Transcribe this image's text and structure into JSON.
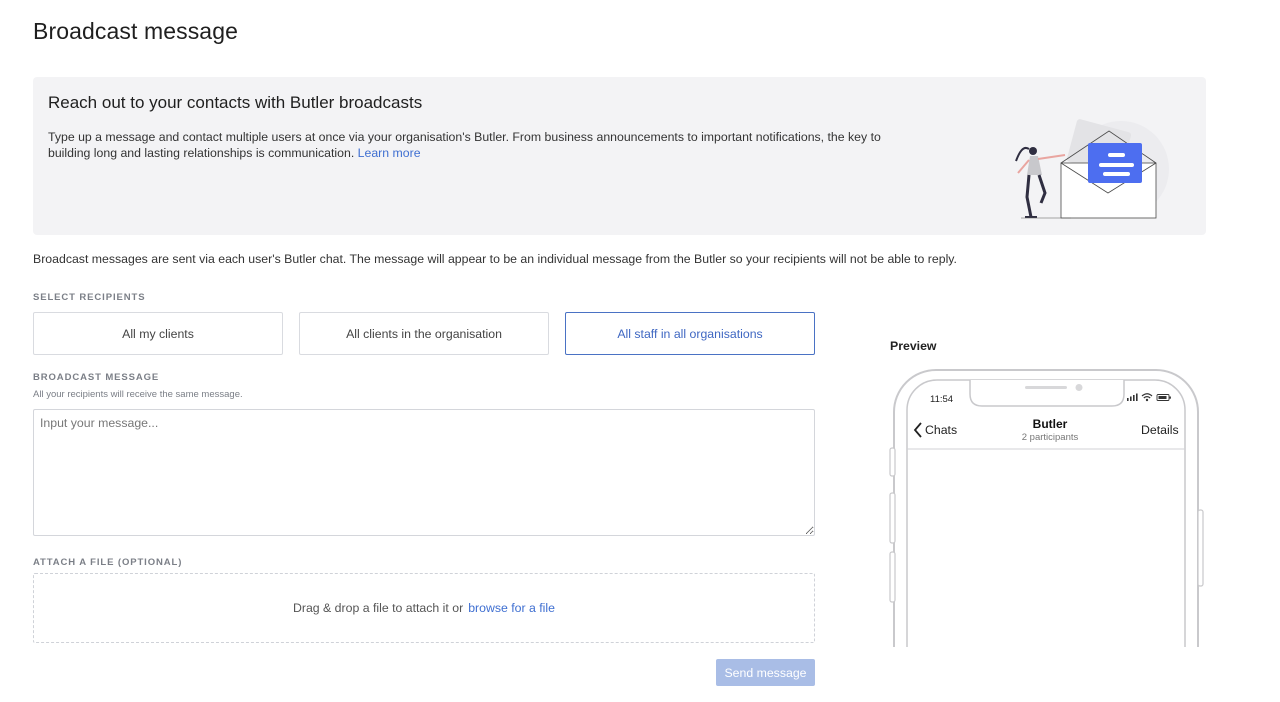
{
  "page": {
    "title": "Broadcast message"
  },
  "hero": {
    "title": "Reach out to your contacts with Butler broadcasts",
    "description": "Type up a message and contact multiple users at once via your organisation's Butler. From business announcements to important notifications, the key to building long and lasting relationships is communication.",
    "learn_more": "Learn more"
  },
  "info": "Broadcast messages are sent via each user's Butler chat. The message will appear to be an individual message from the Butler so your recipients will not be able to reply.",
  "recipients": {
    "label": "SELECT RECIPIENTS",
    "options": [
      {
        "label": "All my clients",
        "selected": false
      },
      {
        "label": "All clients in the organisation",
        "selected": false
      },
      {
        "label": "All staff in all organisations",
        "selected": true
      }
    ]
  },
  "message": {
    "label": "BROADCAST MESSAGE",
    "sublabel": "All your recipients will receive the same message.",
    "placeholder": "Input your message...",
    "value": ""
  },
  "attachment": {
    "label": "ATTACH A FILE (OPTIONAL)",
    "drop_text": "Drag & drop a file to attach it or",
    "browse_link": "browse for a file"
  },
  "send_button": {
    "label": "Send message",
    "enabled": false
  },
  "preview": {
    "label": "Preview",
    "time": "11:54",
    "back_label": "Chats",
    "chat_name": "Butler",
    "chat_sub": "2 participants",
    "details_label": "Details"
  },
  "colors": {
    "accent": "#3f6fd1",
    "hero_bg": "#f3f3f5",
    "send_disabled": "#a9bde6",
    "illustration_blue": "#4d6ef0"
  }
}
